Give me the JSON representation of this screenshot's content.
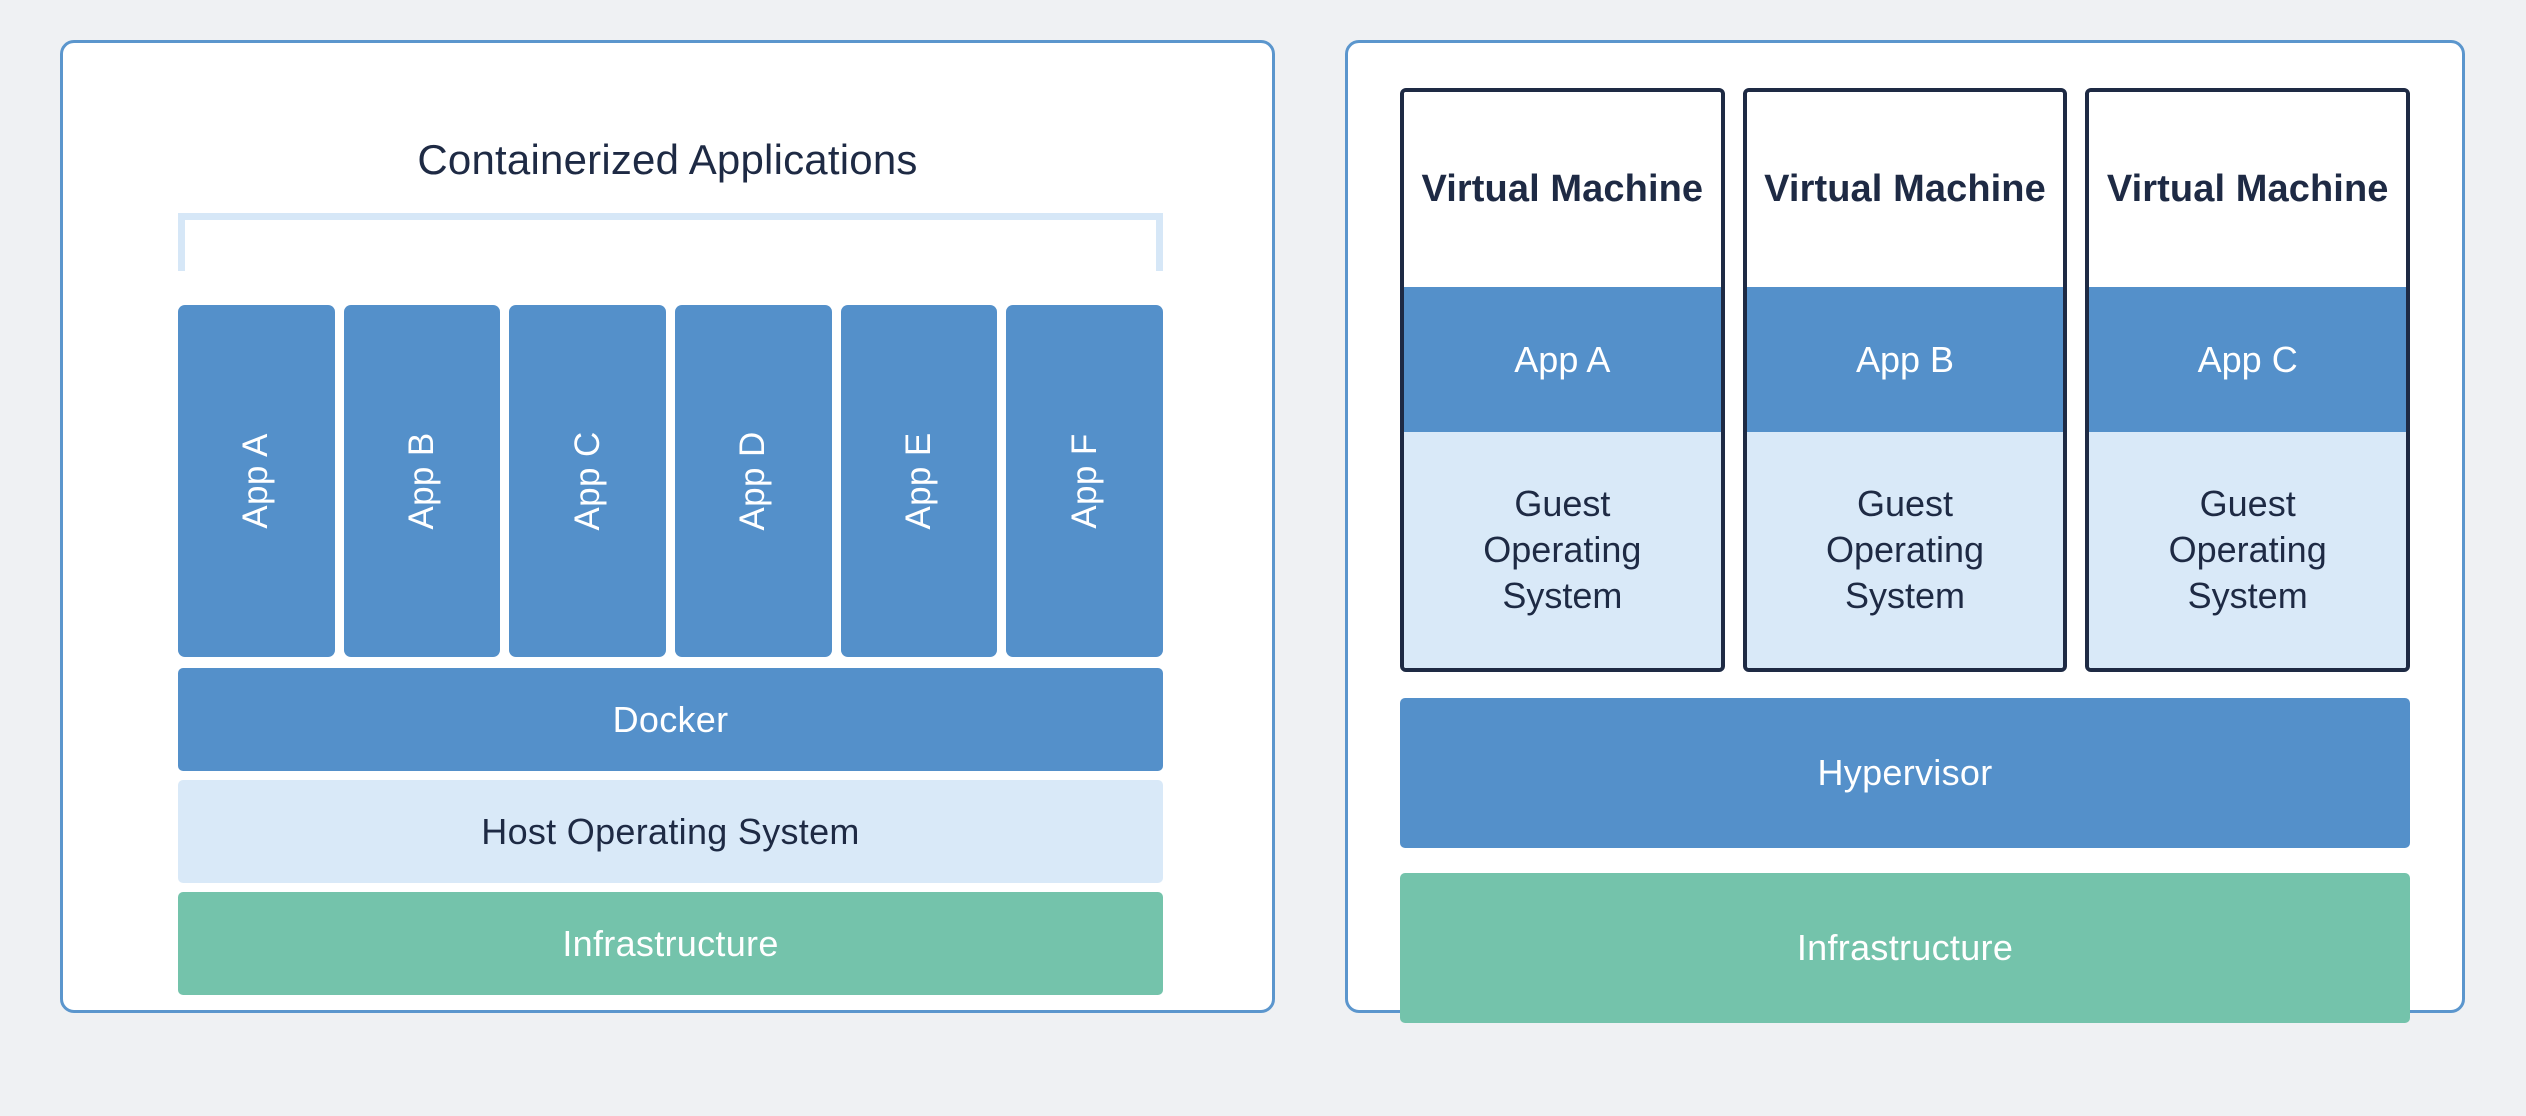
{
  "background_color": "#eff1f3",
  "colors": {
    "panel_border": "#5b96cd",
    "accent_blue": "#5490ca",
    "light_blue": "#d9e9f8",
    "green": "#74c3ab",
    "dark_navy": "#1e2a44",
    "white": "#ffffff"
  },
  "containers_panel": {
    "title": "Containerized Applications",
    "apps": [
      {
        "label": "App A"
      },
      {
        "label": "App B"
      },
      {
        "label": "App C"
      },
      {
        "label": "App D"
      },
      {
        "label": "App E"
      },
      {
        "label": "App F"
      }
    ],
    "layers": [
      {
        "label": "Docker",
        "style": "blue"
      },
      {
        "label": "Host Operating System",
        "style": "light-blue"
      },
      {
        "label": "Infrastructure",
        "style": "green"
      }
    ]
  },
  "vms_panel": {
    "vms": [
      {
        "title": "Virtual Machine",
        "app": "App A",
        "guest_os_line1": "Guest",
        "guest_os_line2": "Operating",
        "guest_os_line3": "System"
      },
      {
        "title": "Virtual Machine",
        "app": "App B",
        "guest_os_line1": "Guest",
        "guest_os_line2": "Operating",
        "guest_os_line3": "System"
      },
      {
        "title": "Virtual Machine",
        "app": "App C",
        "guest_os_line1": "Guest",
        "guest_os_line2": "Operating",
        "guest_os_line3": "System"
      }
    ],
    "layers": [
      {
        "label": "Hypervisor",
        "style": "blue"
      },
      {
        "label": "Infrastructure",
        "style": "green"
      }
    ]
  }
}
